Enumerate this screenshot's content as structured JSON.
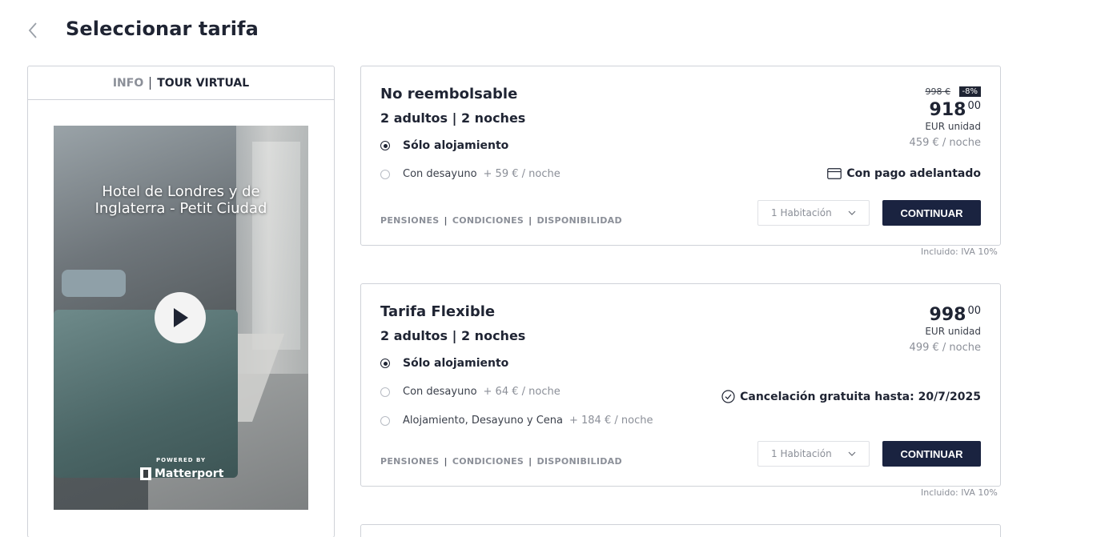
{
  "header": {
    "back_icon": "chevron-left-icon",
    "title": "Seleccionar tarifa"
  },
  "left_panel": {
    "tabs": [
      {
        "label": "INFO",
        "active": false
      },
      {
        "label": "TOUR VIRTUAL",
        "active": true
      }
    ],
    "tour": {
      "title": "Hotel de Londres y de Inglaterra - Petit Ciudad",
      "powered_by": "POWERED BY",
      "brand": "Matterport"
    }
  },
  "rates": [
    {
      "name": "No reembolsable",
      "occupancy": "2 adultos | 2 noches",
      "old_price": "998 €",
      "discount": "-8%",
      "price_int": "918",
      "price_dec": "00",
      "unit": "EUR unidad",
      "per_night": "459 € / noche",
      "policy_icon": "credit-card-icon",
      "policy": "Con pago adelantado",
      "options": [
        {
          "label": "Sólo alojamiento",
          "extra": "",
          "selected": true
        },
        {
          "label": "Con desayuno",
          "extra": "+ 59 € / noche",
          "selected": false
        }
      ],
      "links": [
        "PENSIONES",
        "CONDICIONES",
        "DISPONIBILIDAD"
      ],
      "rooms_select": "1 Habitación",
      "cta": "CONTINUAR",
      "tax_note": "Incluido: IVA 10%"
    },
    {
      "name": "Tarifa Flexible",
      "occupancy": "2 adultos | 2 noches",
      "price_int": "998",
      "price_dec": "00",
      "unit": "EUR unidad",
      "per_night": "499 € / noche",
      "policy_icon": "check-circle-icon",
      "policy": "Cancelación gratuita hasta: 20/7/2025",
      "options": [
        {
          "label": "Sólo alojamiento",
          "extra": "",
          "selected": true
        },
        {
          "label": "Con desayuno",
          "extra": "+ 64 € / noche",
          "selected": false
        },
        {
          "label": "Alojamiento, Desayuno y Cena",
          "extra": "+ 184 € / noche",
          "selected": false
        }
      ],
      "links": [
        "PENSIONES",
        "CONDICIONES",
        "DISPONIBILIDAD"
      ],
      "rooms_select": "1 Habitación",
      "cta": "CONTINUAR",
      "tax_note": "Incluido: IVA 10%"
    }
  ],
  "colors": {
    "primary": "#1a2340",
    "muted": "#8b8f98",
    "border": "#cfd2d8"
  }
}
